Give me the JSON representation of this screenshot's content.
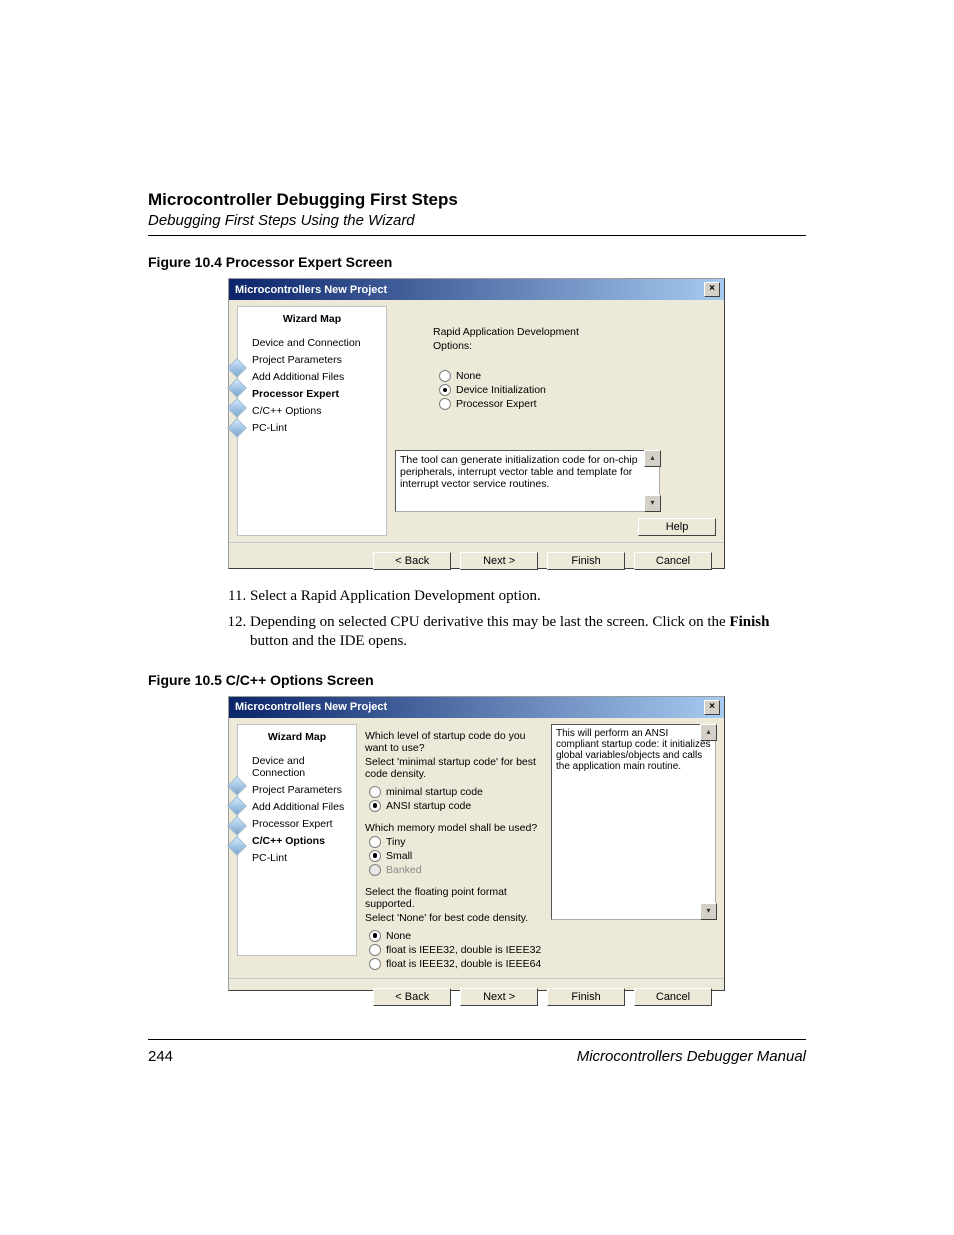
{
  "header": {
    "chapter": "Microcontroller Debugging First Steps",
    "subtitle": "Debugging First Steps Using the Wizard"
  },
  "figure1": {
    "caption": "Figure 10.4  Processor Expert Screen",
    "dialog_title": "Microcontrollers New Project",
    "sidebar": {
      "title": "Wizard Map",
      "items": [
        {
          "label": "Device and Connection",
          "bold": false
        },
        {
          "label": "Project Parameters",
          "bold": false
        },
        {
          "label": "Add Additional Files",
          "bold": false
        },
        {
          "label": "Processor Expert",
          "bold": true
        },
        {
          "label": "C/C++ Options",
          "bold": false
        },
        {
          "label": "PC-Lint",
          "bold": false
        }
      ]
    },
    "main": {
      "heading": "Rapid Application Development",
      "sub": "Options:",
      "radios": [
        {
          "label": "None",
          "selected": false
        },
        {
          "label": "Device Initialization",
          "selected": true
        },
        {
          "label": "Processor Expert",
          "selected": false
        }
      ],
      "desc": "The tool can generate initialization code for on-chip peripherals, interrupt vector table and template for interrupt vector service routines.",
      "help": "Help"
    },
    "buttons": [
      "< Back",
      "Next >",
      "Finish",
      "Cancel"
    ]
  },
  "steps": [
    {
      "num": "11.",
      "text": "Select a Rapid Application Development option."
    },
    {
      "num": "12.",
      "text_pre": "Depending on selected CPU derivative this may be last the screen. Click on the ",
      "bold": "Finish",
      "text_post": " button and the IDE opens."
    }
  ],
  "figure2": {
    "caption": "Figure 10.5  C/C++ Options Screen",
    "dialog_title": "Microcontrollers New Project",
    "sidebar": {
      "title": "Wizard Map",
      "items": [
        {
          "label": "Device and Connection",
          "bold": false
        },
        {
          "label": "Project Parameters",
          "bold": false
        },
        {
          "label": "Add Additional Files",
          "bold": false
        },
        {
          "label": "Processor Expert",
          "bold": false
        },
        {
          "label": "C/C++ Options",
          "bold": true
        },
        {
          "label": "PC-Lint",
          "bold": false
        }
      ]
    },
    "main": {
      "q1": "Which level of startup code do you want to use?",
      "h1": "Select 'minimal startup code' for best code density.",
      "g1": [
        {
          "label": "minimal startup code",
          "selected": false,
          "disabled": false
        },
        {
          "label": "ANSI startup code",
          "selected": true,
          "disabled": false
        }
      ],
      "q2": "Which memory model shall be used?",
      "g2": [
        {
          "label": "Tiny",
          "selected": false,
          "disabled": false
        },
        {
          "label": "Small",
          "selected": true,
          "disabled": false
        },
        {
          "label": "Banked",
          "selected": false,
          "disabled": true
        }
      ],
      "q3": "Select the floating point format supported.",
      "h3": "Select 'None' for best code density.",
      "g3": [
        {
          "label": "None",
          "selected": true,
          "disabled": false
        },
        {
          "label": "float is IEEE32, double is IEEE32",
          "selected": false,
          "disabled": false
        },
        {
          "label": "float is IEEE32, double is IEEE64",
          "selected": false,
          "disabled": false
        }
      ],
      "desc": "This will perform an ANSI compliant startup code: it initializes global variables/objects and calls the application main routine."
    },
    "buttons": [
      "< Back",
      "Next >",
      "Finish",
      "Cancel"
    ]
  },
  "footer": {
    "page": "244",
    "manual": "Microcontrollers Debugger Manual"
  }
}
